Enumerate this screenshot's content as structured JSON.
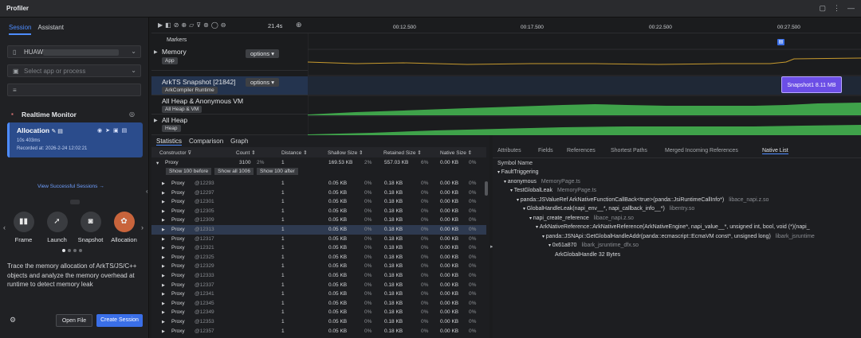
{
  "app_title": "Profiler",
  "left": {
    "tabs": [
      "Session",
      "Assistant"
    ],
    "device": "HUAWEI",
    "app_placeholder": "Select app or process",
    "monitor_title": "Realtime Monitor",
    "session": {
      "name": "Allocation",
      "duration": "10s 403ms",
      "recorded": "Recorded at: 2026-2-24 12:02:21"
    },
    "view_link": "View Successful Sessions →",
    "tools": [
      "Frame",
      "Launch",
      "Snapshot",
      "Allocation"
    ],
    "description": "Trace the memory allocation of ArkTS/JS/C++ objects and analyze the memory overhead at runtime to detect memory leak",
    "open_file": "Open File",
    "create_session": "Create Session"
  },
  "timeline": {
    "duration": "21.4s",
    "ticks": [
      "00:12.500",
      "00:17.500",
      "00:22.500",
      "00:27.500"
    ],
    "markers": "Markers",
    "rows": {
      "memory": {
        "label": "Memory",
        "badge": "App",
        "options": "options"
      },
      "arkts": {
        "label": "ArkTS Snapshot [21842]",
        "badge": "ArkCompiler Runtime",
        "options": "options"
      },
      "allheap": {
        "label": "All Heap & Anonymous VM",
        "badge": "All Heap & VM"
      },
      "heap": {
        "label": "All Heap",
        "badge": "Heap"
      }
    },
    "snapshot_chip": "Snapshot1 8.11 MB"
  },
  "stats": {
    "tabs": [
      "Statistics",
      "Comparison",
      "Graph"
    ],
    "headers": [
      "Constructor",
      "Count",
      "Distance",
      "Shallow Size",
      "Retained Size",
      "Native Size"
    ],
    "group": {
      "name": "Proxy",
      "count": "3100",
      "count_pct": "2%",
      "distance": "1",
      "shallow": "169.53 KB",
      "shallow_pct": "2%",
      "retained": "557.03 KB",
      "retained_pct": "6%",
      "native": "0.00 KB",
      "native_pct": "0%"
    },
    "show_buttons": [
      "Show 100 before",
      "Show all 1006",
      "Show 100 after"
    ],
    "row_ids": [
      "@12293",
      "@12297",
      "@12301",
      "@12305",
      "@12309",
      "@12313",
      "@12317",
      "@12321",
      "@12325",
      "@12329",
      "@12333",
      "@12337",
      "@12341",
      "@12345",
      "@12349",
      "@12353",
      "@12357"
    ],
    "row_name": "Proxy",
    "row_distance": "1",
    "row_shallow": "0.05 KB",
    "row_retained": "0.18 KB",
    "row_native": "0.00 KB",
    "row_pct": "0%"
  },
  "native": {
    "tabs": [
      "Attributes",
      "Fields",
      "References",
      "Shortest Paths",
      "Merged Incoming References",
      "Native List"
    ],
    "header": "Symbol Name",
    "rows": [
      {
        "text": "FaultTriggering",
        "sub": ""
      },
      {
        "text": "anonymous",
        "sub": "MemoryPage.ts"
      },
      {
        "text": "TestGlobalLeak",
        "sub": "MemoryPage.ts"
      },
      {
        "text": "panda::JSValueRef ArkNativeFunctionCallBack<true>(panda::JsiRuntimeCallInfo*)",
        "sub": "libace_napi.z.so"
      },
      {
        "text": "GlobalHandleLeak(napi_env__*, napi_callback_info__*)",
        "sub": "libentry.so"
      },
      {
        "text": "napi_create_reference",
        "sub": "libace_napi.z.so"
      },
      {
        "text": "ArkNativeReference::ArkNativeReference(ArkNativeEngine*, napi_value__*, unsigned int, bool, void (*)(napi_",
        "sub": ""
      },
      {
        "text": "panda::JSNApi::GetGlobalHandleAddr(panda::ecmascript::EcmaVM const*, unsigned long)",
        "sub": "libark_jsruntime"
      },
      {
        "text": "0x61a870",
        "sub": "libark_jsruntime_dfx.so"
      },
      {
        "text": "ArkGlobalHandle 32 Bytes",
        "sub": ""
      }
    ]
  }
}
